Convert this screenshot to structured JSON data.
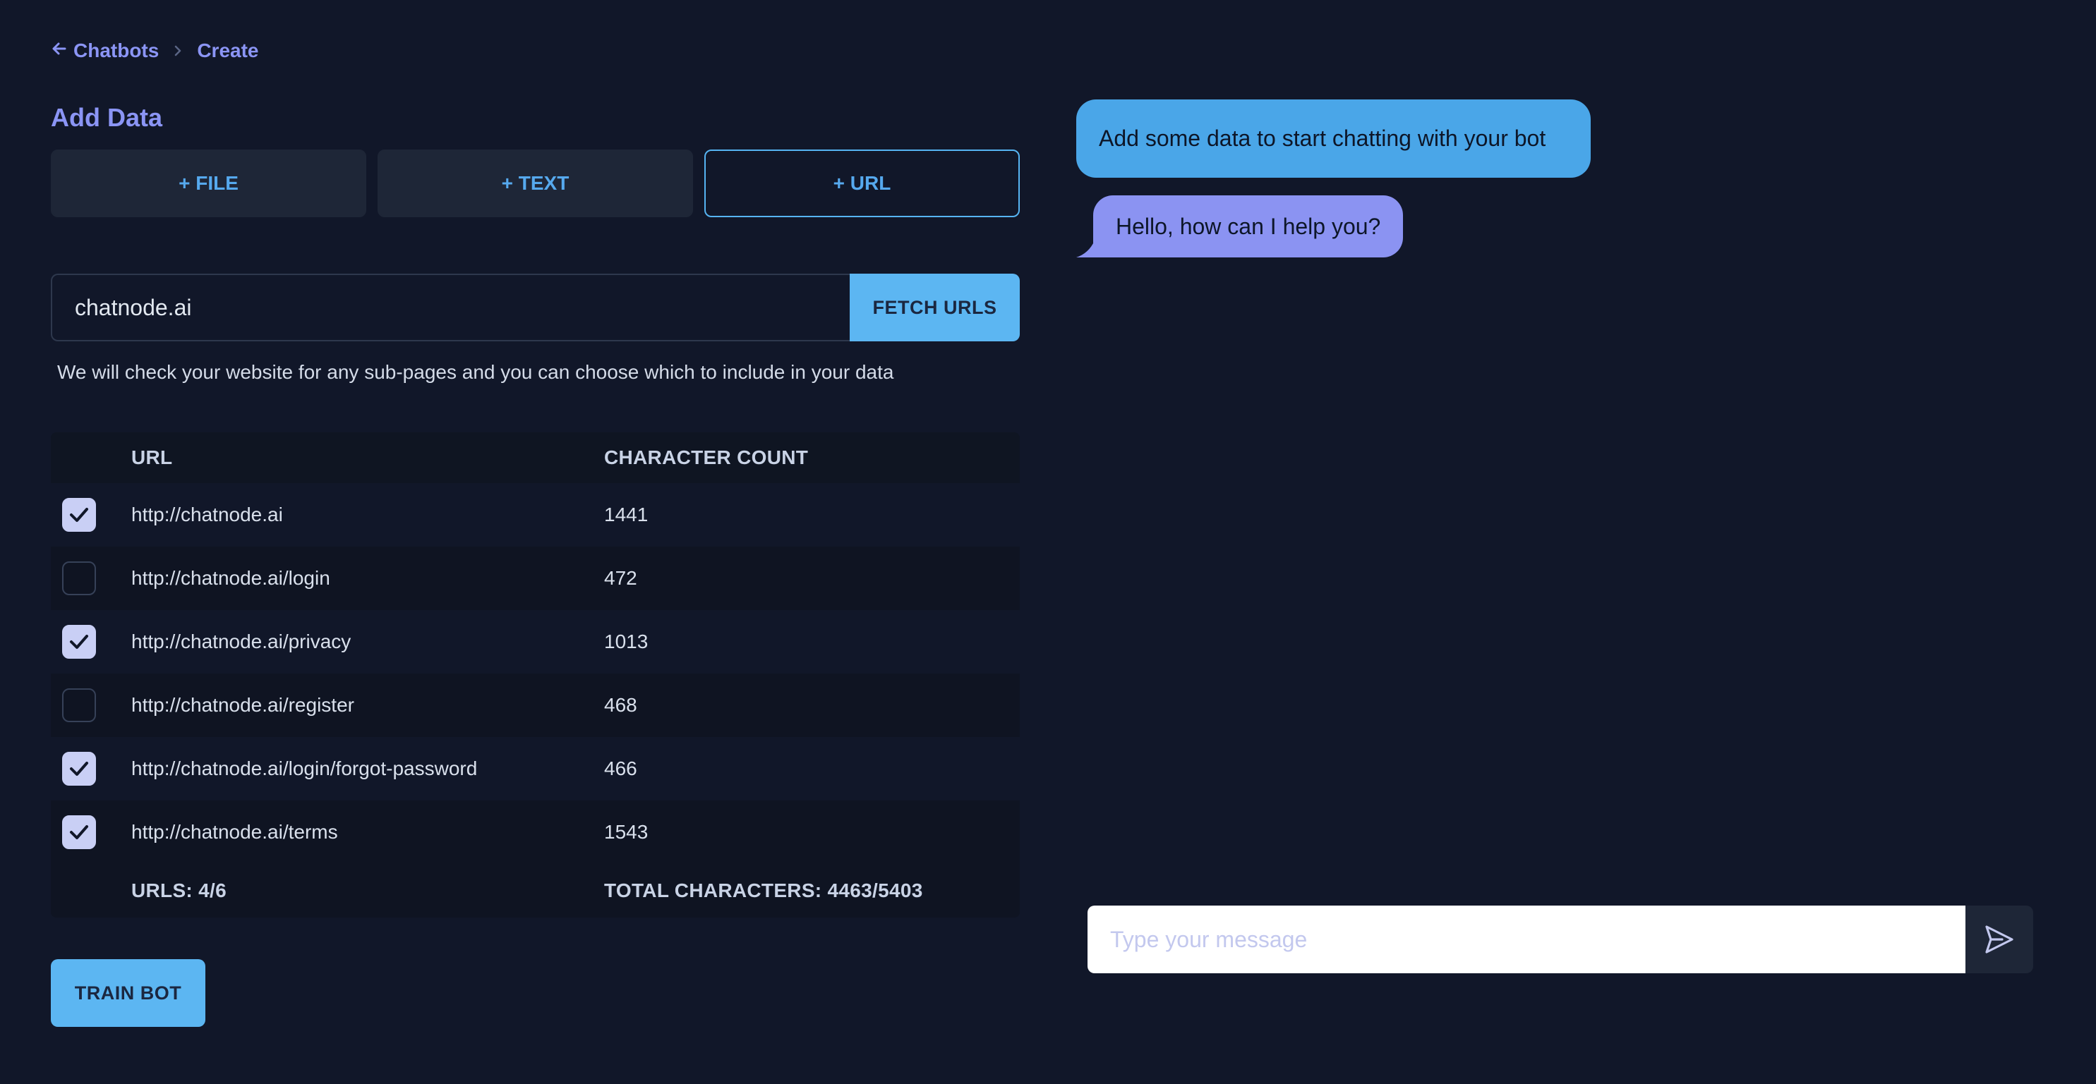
{
  "breadcrumb": {
    "back_label": "Chatbots",
    "current_label": "Create"
  },
  "add_data": {
    "title": "Add Data",
    "tabs": [
      {
        "label": "+ FILE",
        "active": false
      },
      {
        "label": "+ TEXT",
        "active": false
      },
      {
        "label": "+ URL",
        "active": true
      }
    ]
  },
  "url_fetch": {
    "value": "chatnode.ai",
    "button_label": "FETCH URLS",
    "help_text": "We will check your website for any sub-pages and you can choose which to include in your data"
  },
  "url_table": {
    "headers": {
      "url": "URL",
      "count": "CHARACTER COUNT"
    },
    "rows": [
      {
        "url": "http://chatnode.ai",
        "count": "1441",
        "checked": true
      },
      {
        "url": "http://chatnode.ai/login",
        "count": "472",
        "checked": false
      },
      {
        "url": "http://chatnode.ai/privacy",
        "count": "1013",
        "checked": true
      },
      {
        "url": "http://chatnode.ai/register",
        "count": "468",
        "checked": false
      },
      {
        "url": "http://chatnode.ai/login/forgot-password",
        "count": "466",
        "checked": true
      },
      {
        "url": "http://chatnode.ai/terms",
        "count": "1543",
        "checked": true
      }
    ],
    "footer": {
      "urls": "URLS: 4/6",
      "total": "TOTAL CHARACTERS: 4463/5403"
    }
  },
  "train_button_label": "TRAIN BOT",
  "chat": {
    "messages": [
      {
        "role": "system",
        "text": "Add some data to start chatting with your bot"
      },
      {
        "role": "assistant",
        "text": "Hello, how can I help you?"
      }
    ],
    "input_placeholder": "Type your message"
  },
  "icons": {
    "back": "arrow-left-icon",
    "separator": "chevron-right-icon",
    "check": "checkmark-icon",
    "send": "send-icon"
  },
  "colors": {
    "background": "#111729",
    "accent": "#8b95f5",
    "primary_button": "#5cb6f2",
    "bot_bubble": "#4aa6e8",
    "user_bubble": "#8b93f2"
  }
}
